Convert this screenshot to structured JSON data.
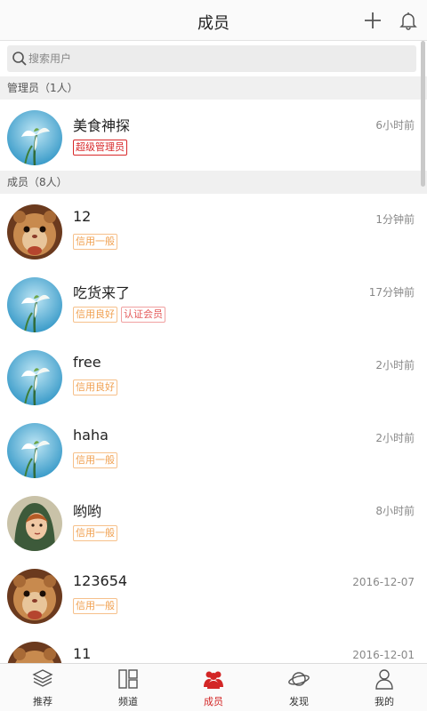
{
  "header": {
    "title": "成员",
    "add_icon": "plus-icon",
    "notify_icon": "bell-icon"
  },
  "search": {
    "placeholder": "搜索用户",
    "value": "",
    "icon": "search-icon"
  },
  "sections": {
    "admins": {
      "label": "管理员（1人）"
    },
    "members": {
      "label": "成员（8人）"
    }
  },
  "admins": [
    {
      "name": "美食神探",
      "time": "6小时前",
      "avatar": "snowdrop-flower",
      "badges": [
        {
          "text": "超级管理员",
          "style": "red"
        }
      ]
    }
  ],
  "members": [
    {
      "name": "12",
      "time": "1分钟前",
      "avatar": "hamster",
      "badges": [
        {
          "text": "信用一般",
          "style": "orange"
        }
      ]
    },
    {
      "name": "吃货来了",
      "time": "17分钟前",
      "avatar": "snowdrop-flower",
      "badges": [
        {
          "text": "信用良好",
          "style": "orange"
        },
        {
          "text": "认证会员",
          "style": "pink"
        }
      ]
    },
    {
      "name": "free",
      "time": "2小时前",
      "avatar": "snowdrop-flower",
      "badges": [
        {
          "text": "信用良好",
          "style": "orange"
        }
      ]
    },
    {
      "name": "haha",
      "time": "2小时前",
      "avatar": "snowdrop-flower",
      "badges": [
        {
          "text": "信用一般",
          "style": "orange"
        }
      ]
    },
    {
      "name": "哟哟",
      "time": "8小时前",
      "avatar": "hooded-character",
      "badges": [
        {
          "text": "信用一般",
          "style": "orange"
        }
      ]
    },
    {
      "name": "123654",
      "time": "2016-12-07",
      "avatar": "hamster",
      "badges": [
        {
          "text": "信用一般",
          "style": "orange"
        }
      ]
    },
    {
      "name": "11",
      "time": "2016-12-01",
      "avatar": "hamster",
      "badges": []
    }
  ],
  "tabs": [
    {
      "label": "推荐",
      "icon": "layers-icon",
      "active": false
    },
    {
      "label": "频道",
      "icon": "grid-icon",
      "active": false
    },
    {
      "label": "成员",
      "icon": "members-icon",
      "active": true
    },
    {
      "label": "发现",
      "icon": "planet-icon",
      "active": false
    },
    {
      "label": "我的",
      "icon": "person-icon",
      "active": false
    }
  ],
  "colors": {
    "accent": "#d32626",
    "badge_orange": "#f0a050",
    "badge_red": "#d8282a",
    "section_bg": "#f0f0f0"
  }
}
